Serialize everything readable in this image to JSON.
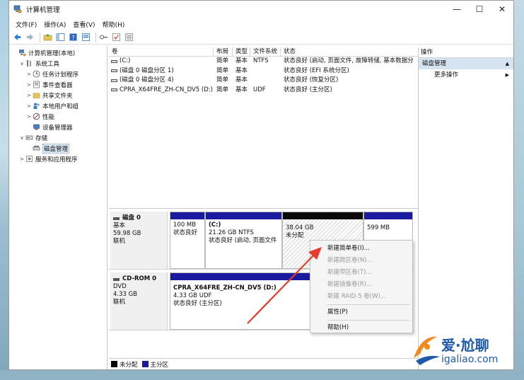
{
  "window": {
    "title": "计算机管理",
    "controls": [
      "—",
      "☐",
      "✕"
    ]
  },
  "menu": [
    "文件(F)",
    "操作(A)",
    "查看(V)",
    "帮助(H)"
  ],
  "tree": [
    {
      "label": "计算机管理(本地)",
      "twisty": "",
      "icon": "computer-management-icon",
      "indent": 0
    },
    {
      "label": "系统工具",
      "twisty": "∨",
      "icon": "system-tools-icon",
      "indent": 1
    },
    {
      "label": "任务计划程序",
      "twisty": ">",
      "icon": "task-scheduler-icon",
      "indent": 2
    },
    {
      "label": "事件查看器",
      "twisty": ">",
      "icon": "event-viewer-icon",
      "indent": 2
    },
    {
      "label": "共享文件夹",
      "twisty": ">",
      "icon": "shared-folder-icon",
      "indent": 2
    },
    {
      "label": "本地用户和组",
      "twisty": ">",
      "icon": "users-icon",
      "indent": 2
    },
    {
      "label": "性能",
      "twisty": ">",
      "icon": "performance-icon",
      "indent": 2
    },
    {
      "label": "设备管理器",
      "twisty": "",
      "icon": "device-manager-icon",
      "indent": 2
    },
    {
      "label": "存储",
      "twisty": "∨",
      "icon": "storage-icon",
      "indent": 1
    },
    {
      "label": "磁盘管理",
      "twisty": "",
      "icon": "disk-management-icon",
      "indent": 2,
      "selected": true
    },
    {
      "label": "服务和应用程序",
      "twisty": ">",
      "icon": "services-icon",
      "indent": 1
    }
  ],
  "volume_list": {
    "columns": [
      "卷",
      "布局",
      "类型",
      "文件系统",
      "状态"
    ],
    "rows": [
      [
        "(C:)",
        "简单",
        "基本",
        "NTFS",
        "状态良好 (启动, 页面文件, 故障转储, 基本数据分"
      ],
      [
        "(磁盘 0 磁盘分区 1)",
        "简单",
        "基本",
        "",
        "状态良好 (EFI 系统分区)"
      ],
      [
        "(磁盘 0 磁盘分区 4)",
        "简单",
        "基本",
        "",
        "状态良好 (恢复分区)"
      ],
      [
        "CPRA_X64FRE_ZH-CN_DV5 (D:)",
        "简单",
        "基本",
        "UDF",
        "状态良好 (主分区)"
      ]
    ]
  },
  "disks": [
    {
      "name": "磁盘 0",
      "type": "基本",
      "size": "59.98 GB",
      "status": "联机",
      "partitions": [
        {
          "name": "",
          "size": "100 MB",
          "status": "状态良好",
          "kind": "primary"
        },
        {
          "name": "(C:)",
          "size": "21.26 GB NTFS",
          "status": "状态良好 (启动, 页面文件",
          "kind": "primary"
        },
        {
          "name": "",
          "size": "38.04 GB",
          "status": "未分配",
          "kind": "unallocated"
        },
        {
          "name": "",
          "size": "599 MB",
          "status": "",
          "kind": "primary"
        }
      ]
    },
    {
      "name": "CD-ROM 0",
      "type": "DVD",
      "size": "4.33 GB",
      "status": "联机",
      "partitions": [
        {
          "name": "CPRA_X64FRE_ZH-CN_DV5  (D:)",
          "size": "4.33 GB UDF",
          "status": "状态良好 (主分区)",
          "kind": "primary"
        }
      ]
    }
  ],
  "legend": [
    {
      "label": "未分配",
      "color": "#000000"
    },
    {
      "label": "主分区",
      "color": "#1a1aa0"
    }
  ],
  "actions": {
    "header": "操作",
    "selected": "磁盘管理",
    "more": "更多操作"
  },
  "context_menu": [
    {
      "label": "新建简单卷(I)...",
      "enabled": true
    },
    {
      "label": "新建跨区卷(N)...",
      "enabled": false
    },
    {
      "label": "新建带区卷(T)...",
      "enabled": false
    },
    {
      "label": "新建镜像卷(R)...",
      "enabled": false
    },
    {
      "label": "新建 RAID-5 卷(W)...",
      "enabled": false
    },
    {
      "sep": true
    },
    {
      "label": "属性(P)",
      "enabled": true
    },
    {
      "sep": true
    },
    {
      "label": "帮助(H)",
      "enabled": true
    }
  ],
  "watermark": {
    "cn": "爱·尬聊",
    "en": "igaliao.com"
  },
  "colors": {
    "primary": "#1a1aa0",
    "accent_arrow": "#e53a2c",
    "selection": "#d6e4f2"
  }
}
